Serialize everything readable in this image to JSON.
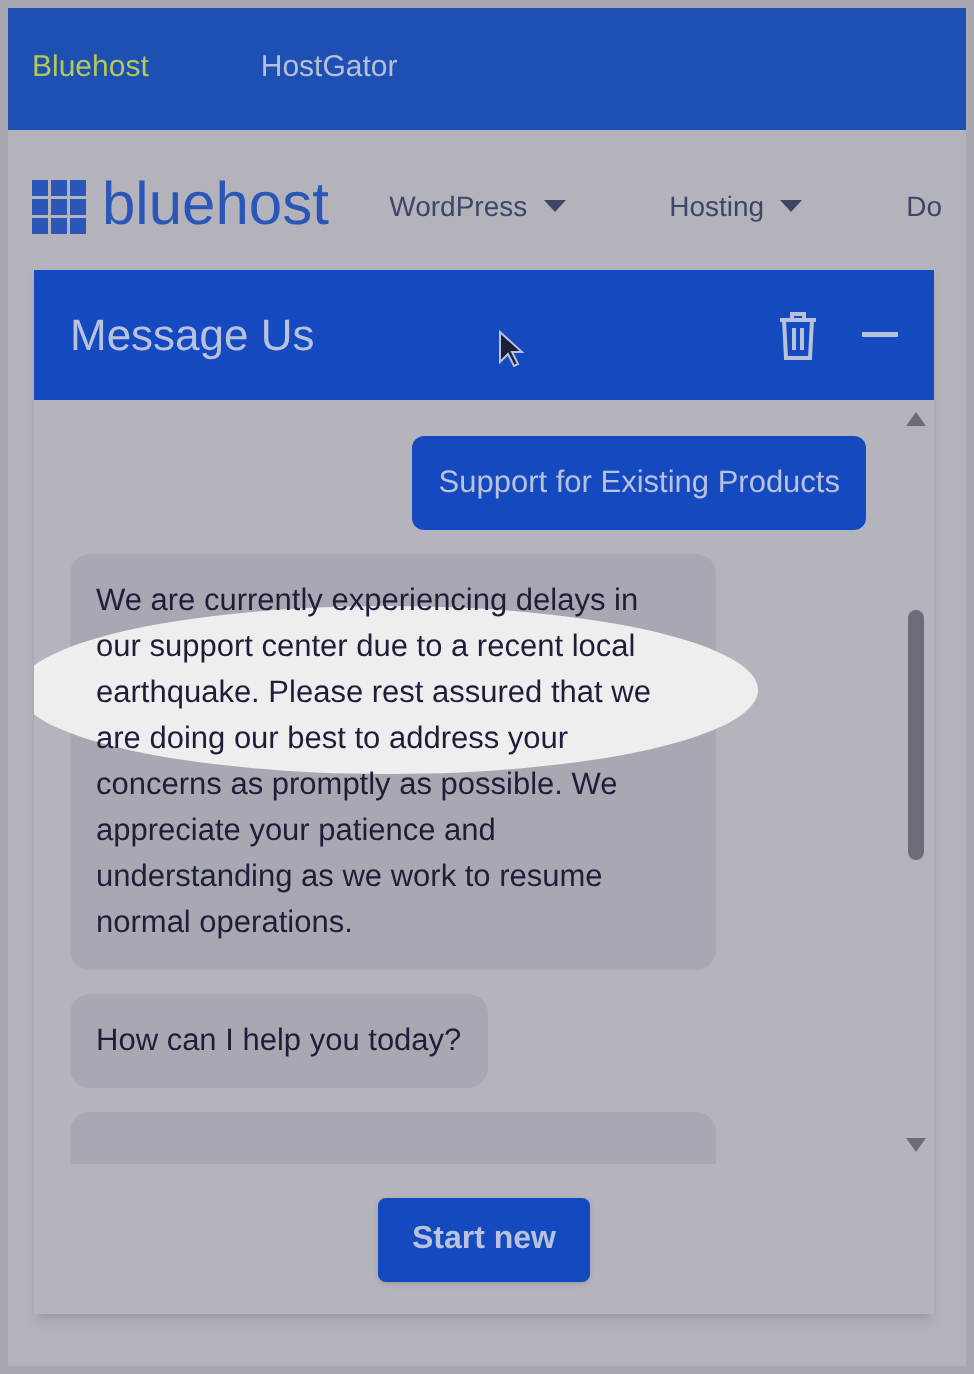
{
  "top_bar": {
    "links": [
      {
        "label": "Bluehost",
        "selected": true
      },
      {
        "label": "HostGator",
        "selected": false
      }
    ]
  },
  "header": {
    "logo": "bluehost",
    "nav": [
      {
        "label": "WordPress",
        "caret": true
      },
      {
        "label": "Hosting",
        "caret": true
      },
      {
        "label": "Do",
        "caret": false
      }
    ]
  },
  "chat": {
    "title": "Message Us",
    "messages": [
      {
        "kind": "user",
        "text": "Support for Existing Products",
        "highlighted": false
      },
      {
        "kind": "agent",
        "text": "We are currently experiencing delays in our support center due to a recent local earthquake. Please rest assured that we are doing our best to address your concerns as promptly as possible. We appreciate your patience and understanding as we work to resume normal operations.",
        "highlighted": true
      },
      {
        "kind": "agent",
        "text": "How can I help you today?",
        "highlighted": false
      }
    ],
    "button": "Start new"
  }
}
